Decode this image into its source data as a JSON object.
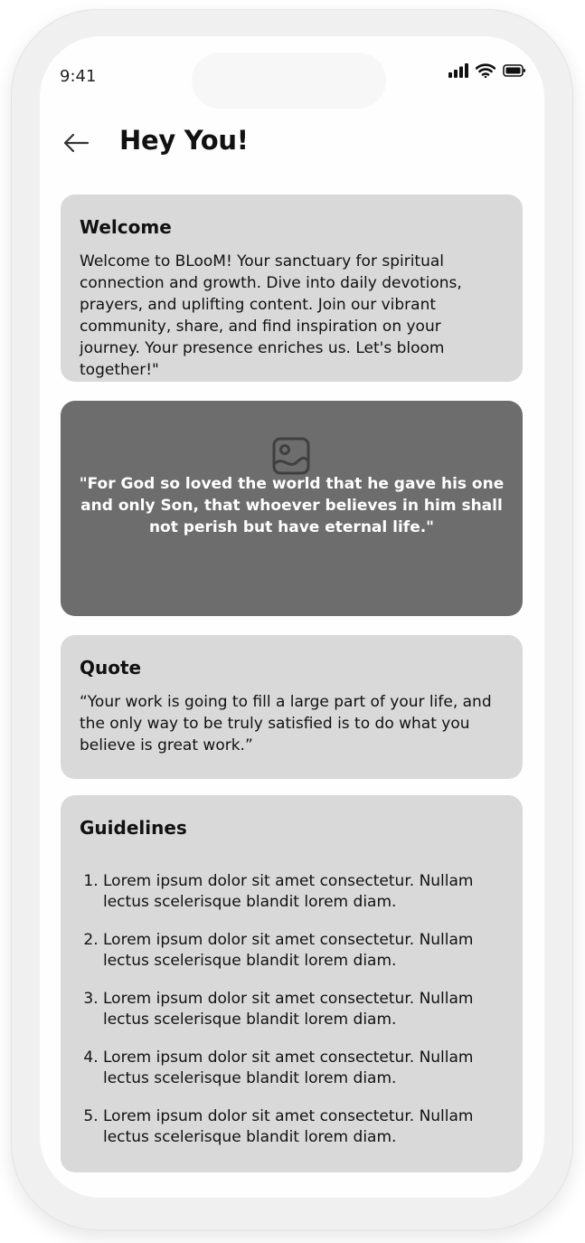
{
  "status_bar": {
    "time": "9:41"
  },
  "header": {
    "title": "Hey You!"
  },
  "welcome_card": {
    "title": "Welcome",
    "body": "Welcome to BLooM! Your sanctuary for spiritual connection and growth. Dive into daily devotions, prayers, and uplifting content. Join our vibrant community, share, and find inspiration on your journey. Your presence enriches us. Let's bloom together!\""
  },
  "verse_card": {
    "text": "\"For God so loved the world that he gave his one and only Son, that whoever believes in him shall not perish but have eternal life.\""
  },
  "quote_card": {
    "title": "Quote",
    "body": "“Your work is going to fill a large part of your life, and the only way to be truly satisfied is to do what you believe is great work.”"
  },
  "guidelines_card": {
    "title": "Guidelines",
    "items": [
      "Lorem ipsum dolor sit amet consectetur. Nullam lectus scelerisque blandit lorem diam.",
      "Lorem ipsum dolor sit amet consectetur. Nullam lectus scelerisque blandit lorem diam.",
      "Lorem ipsum dolor sit amet consectetur. Nullam lectus scelerisque blandit lorem diam.",
      "Lorem ipsum dolor sit amet consectetur. Nullam lectus scelerisque blandit lorem diam.",
      "Lorem ipsum dolor sit amet consectetur. Nullam lectus scelerisque blandit lorem diam."
    ]
  },
  "icons": {
    "back": "arrow-left-icon",
    "image": "image-placeholder-icon",
    "signal": "cellular-signal-icon",
    "wifi": "wifi-icon",
    "battery": "battery-icon"
  },
  "colors": {
    "card_background": "#d9d9d9",
    "verse_background": "#6d6d6d",
    "text": "#111111"
  }
}
